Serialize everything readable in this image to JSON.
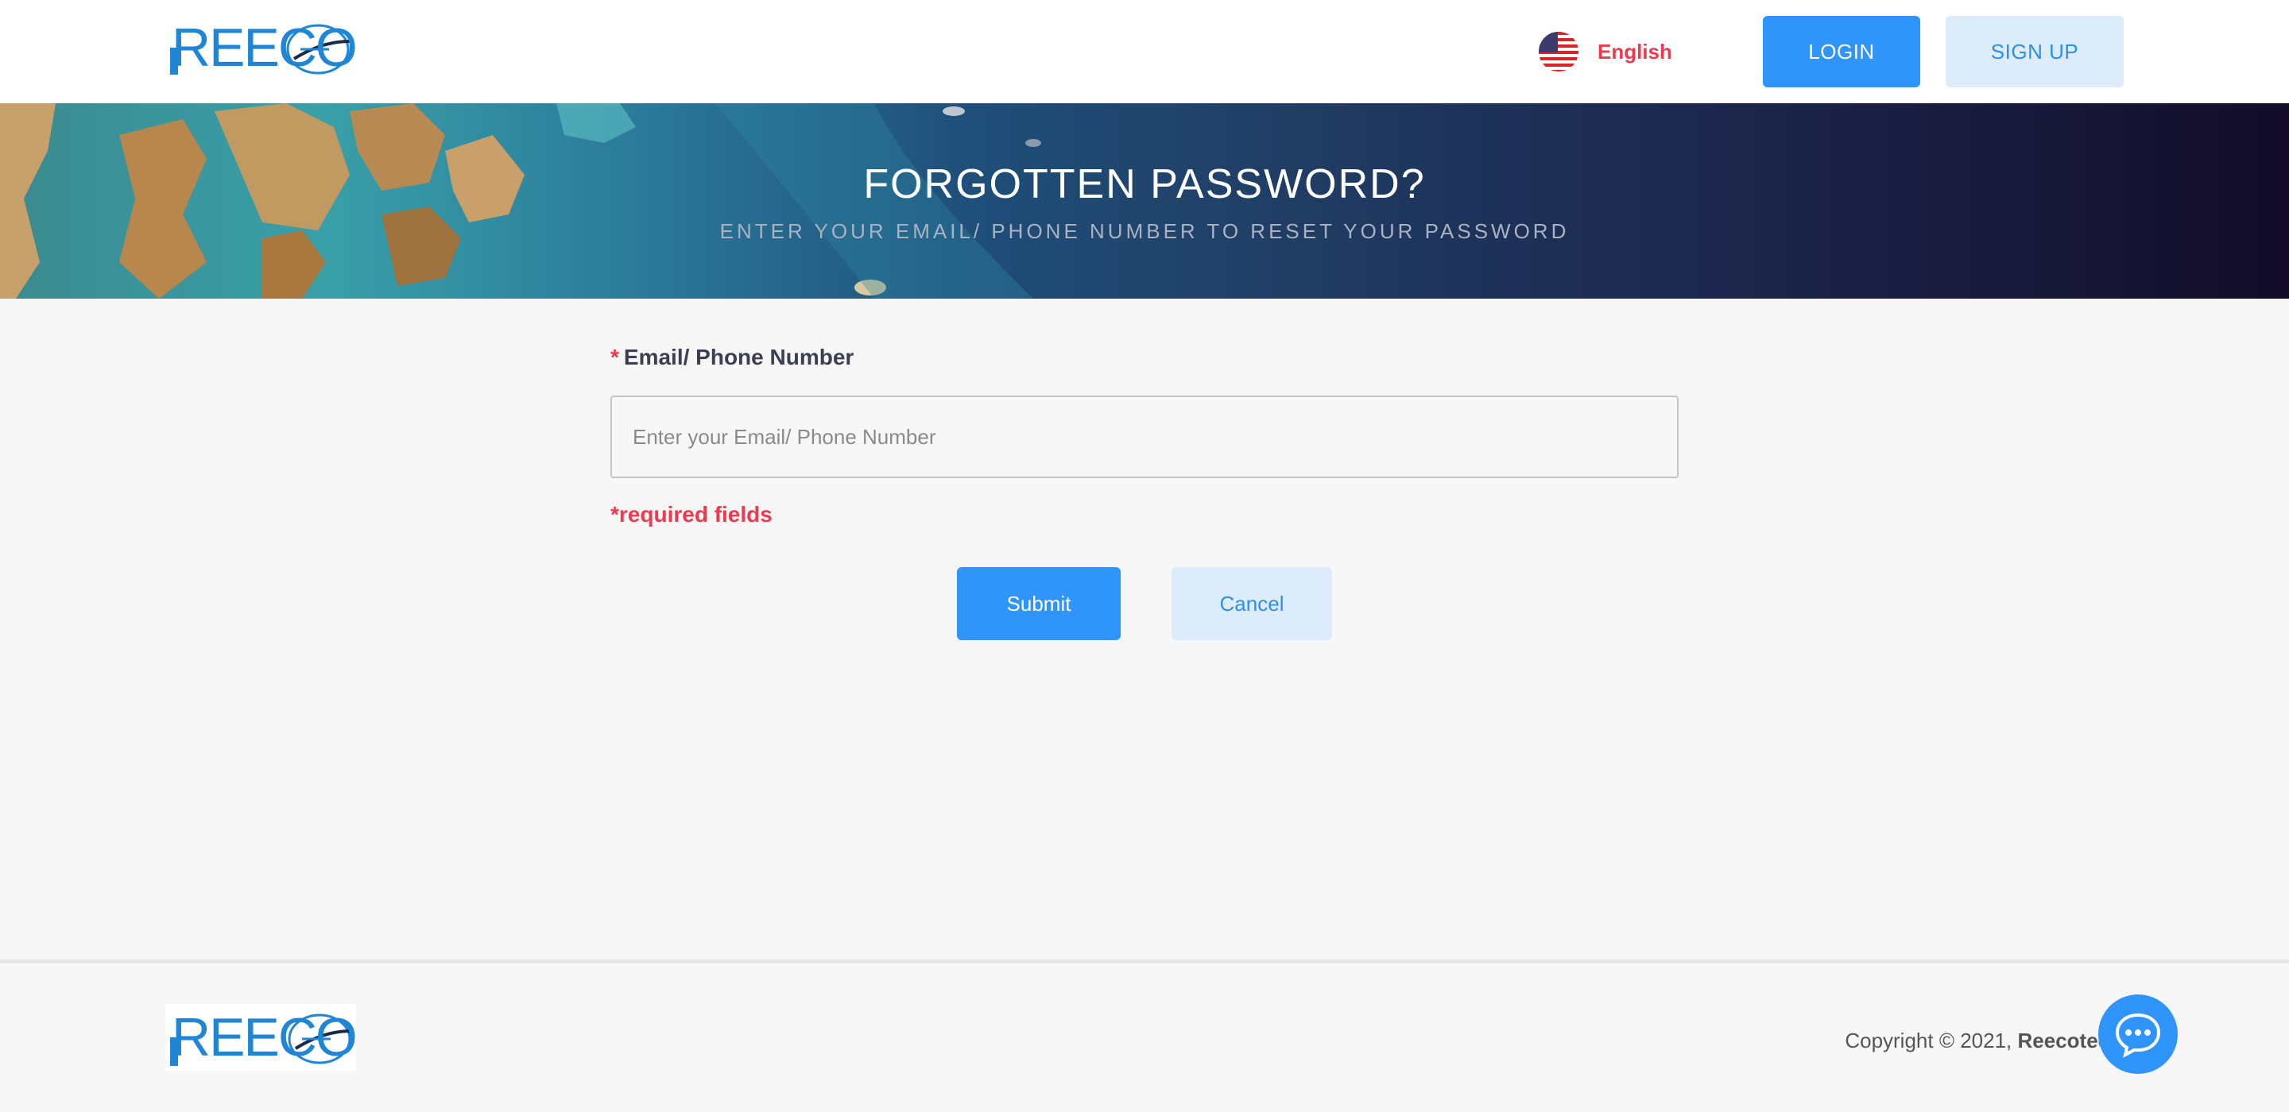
{
  "header": {
    "logo_text": "REECO",
    "language": {
      "label": "English",
      "flag": "us-flag-icon"
    },
    "login_label": "LOGIN",
    "signup_label": "SIGN UP"
  },
  "banner": {
    "title": "FORGOTTEN PASSWORD?",
    "subtitle": "ENTER YOUR EMAIL/ PHONE NUMBER TO RESET YOUR PASSWORD"
  },
  "form": {
    "required_mark": "*",
    "field_label": "Email/ Phone Number",
    "field_placeholder": "Enter your Email/ Phone Number",
    "field_value": "",
    "required_note": "*required fields",
    "submit_label": "Submit",
    "cancel_label": "Cancel"
  },
  "footer": {
    "logo_text": "REECO",
    "copyright_prefix": "Copyright © 2021, ",
    "copyright_brand": "Reecotech"
  },
  "colors": {
    "primary": "#2f95fb",
    "primary_light": "#dcecfb",
    "accent_red": "#f0394f",
    "logo_blue": "#1f86d6"
  },
  "icons": {
    "chat": "chat-bubble-icon"
  }
}
